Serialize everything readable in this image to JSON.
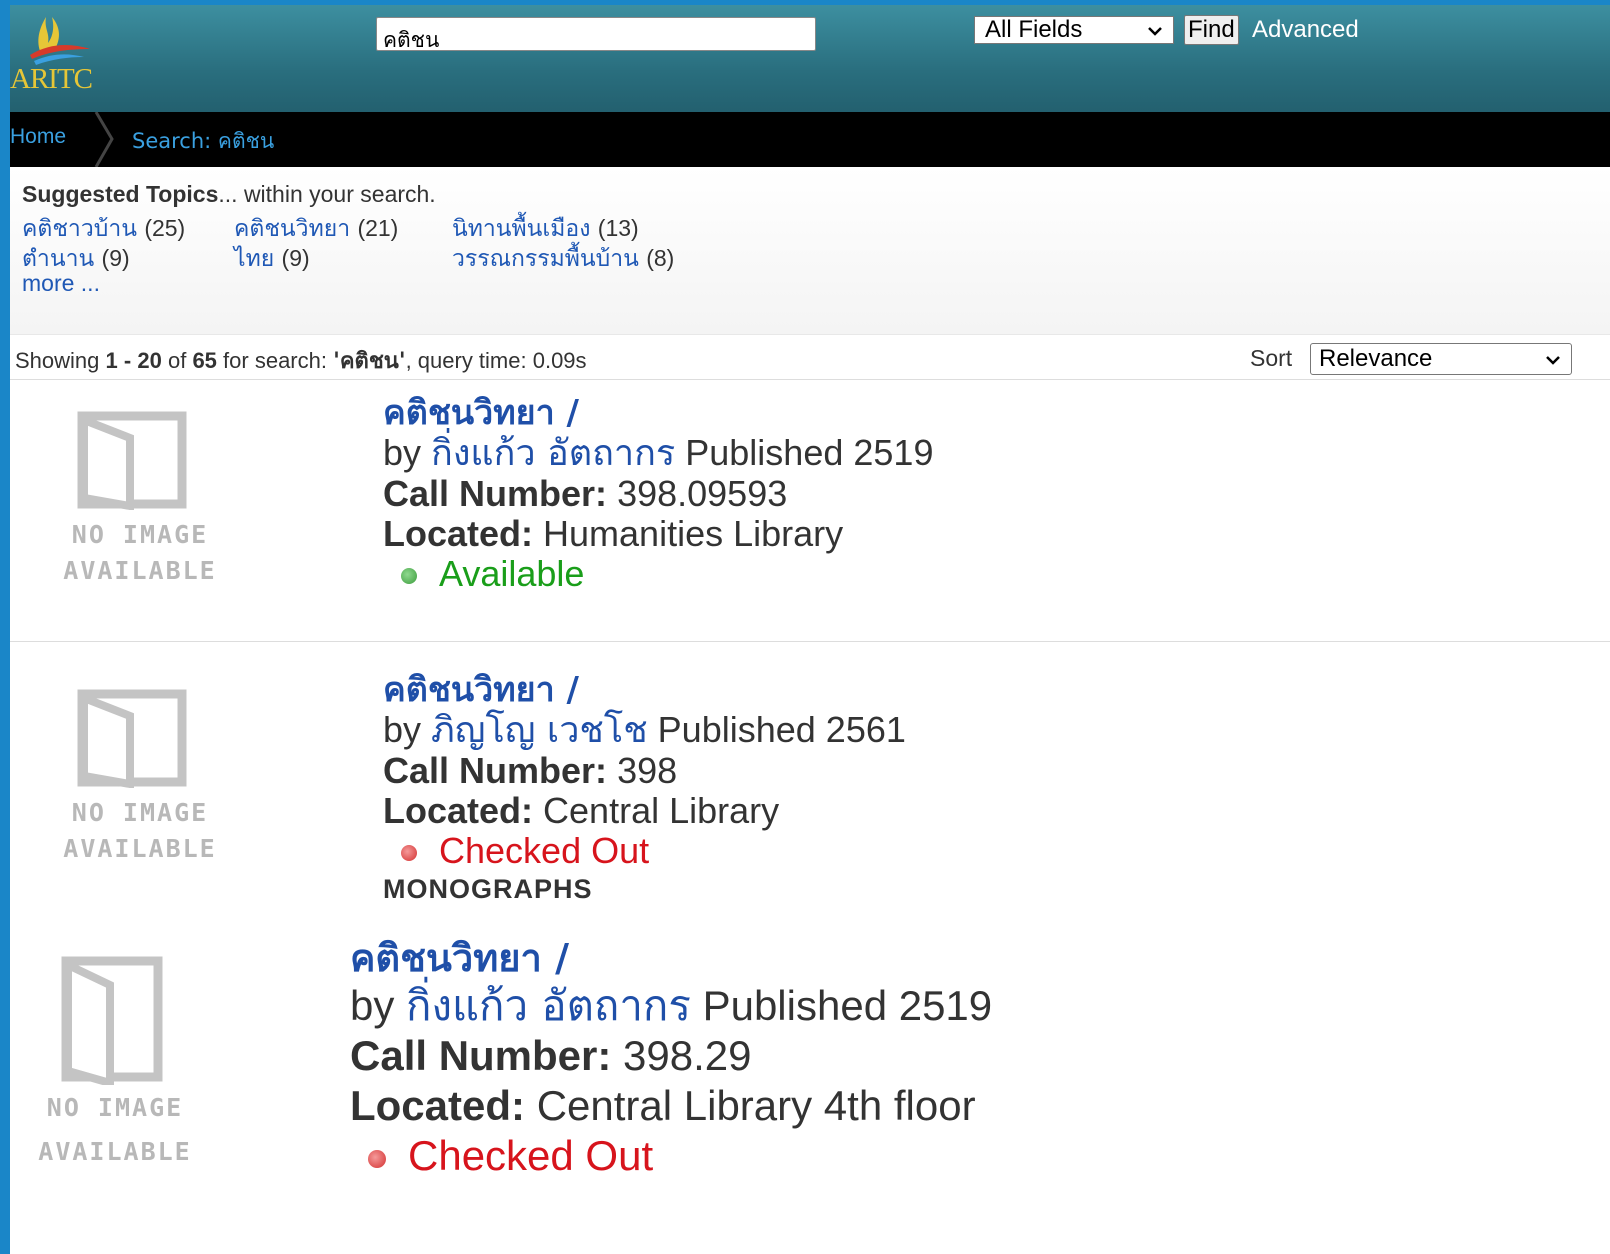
{
  "header": {
    "logo_text": "ARITC",
    "search_value": "คติชน",
    "field_select": "All Fields",
    "find_label": "Find",
    "advanced_label": "Advanced"
  },
  "breadcrumb": {
    "home": "Home",
    "current": "Search: คติชน"
  },
  "topics": {
    "heading_bold": "Suggested Topics",
    "heading_rest": "... within your search.",
    "items": [
      {
        "label": "คติชาวบ้าน",
        "count": "(25)"
      },
      {
        "label": "คติชนวิทยา",
        "count": "(21)"
      },
      {
        "label": "นิทานพื้นเมือง",
        "count": "(13)"
      },
      {
        "label": "ตำนาน",
        "count": "(9)"
      },
      {
        "label": "ไทย",
        "count": "(9)"
      },
      {
        "label": "วรรณกรรมพื้นบ้าน",
        "count": "(8)"
      }
    ],
    "more": "more ..."
  },
  "summary": {
    "showing": "Showing",
    "range_start": "1",
    "dash": "-",
    "range_end": "20",
    "of": "of",
    "total": "65",
    "for_search": "for search:",
    "query": "'คติชน'",
    "query_time": ", query time: 0.09s"
  },
  "sort": {
    "label": "Sort",
    "value": "Relevance"
  },
  "placeholder": {
    "line1": "NO IMAGE",
    "line2": "AVAILABLE"
  },
  "labels": {
    "by": "by",
    "published": "Published",
    "call_number": "Call Number:",
    "located": "Located:"
  },
  "results": [
    {
      "title": "คติชนวิทยา /",
      "author": "กิ่งแก้ว อัตถากร",
      "year": "2519",
      "call_number": "398.09593",
      "location": "Humanities Library",
      "status": "Available",
      "status_color": "#1a9e1a"
    },
    {
      "title": "คติชนวิทยา /",
      "author": "ภิญโญ เวชโช",
      "year": "2561",
      "call_number": "398",
      "location": "Central Library",
      "status": "Checked Out",
      "status_color": "#d7141c",
      "format": "MONOGRAPHS"
    },
    {
      "title": "คติชนวิทยา /",
      "author": "กิ่งแก้ว อัตถากร",
      "year": "2519",
      "call_number": "398.29",
      "location": "Central Library 4th floor",
      "status": "Checked Out",
      "status_color": "#d7141c"
    }
  ],
  "colors": {
    "header_teal": "#2a6f7f",
    "link_blue": "#1f4fa8",
    "available_green": "#1a9e1a",
    "checked_out_red": "#d7141c"
  }
}
